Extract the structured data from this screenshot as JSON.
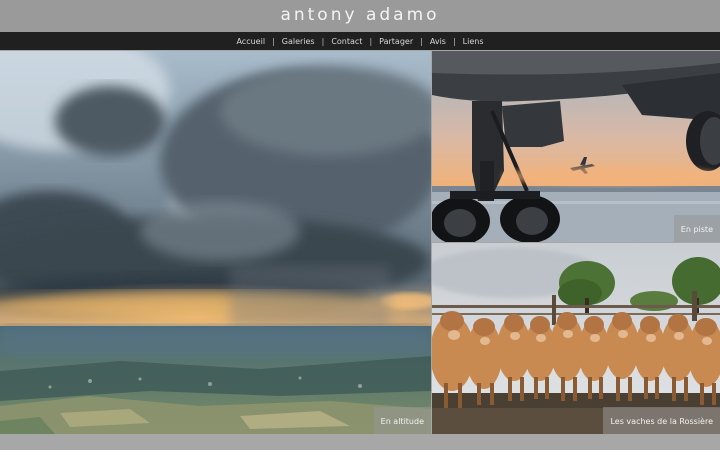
{
  "site": {
    "title": "antony adamo"
  },
  "nav": {
    "items": [
      {
        "label": "Accueil"
      },
      {
        "label": "Galeries"
      },
      {
        "label": "Contact"
      },
      {
        "label": "Partager"
      },
      {
        "label": "Avis"
      },
      {
        "label": "Liens"
      }
    ],
    "separator": "|"
  },
  "gallery": {
    "tiles": [
      {
        "label": "En altitude"
      },
      {
        "label": "En piste"
      },
      {
        "label": "Les vaches de la Rossière"
      }
    ]
  },
  "colors": {
    "header_bg": "#9a9a9a",
    "nav_bg": "#202020",
    "page_bg": "#a7a7a7"
  }
}
